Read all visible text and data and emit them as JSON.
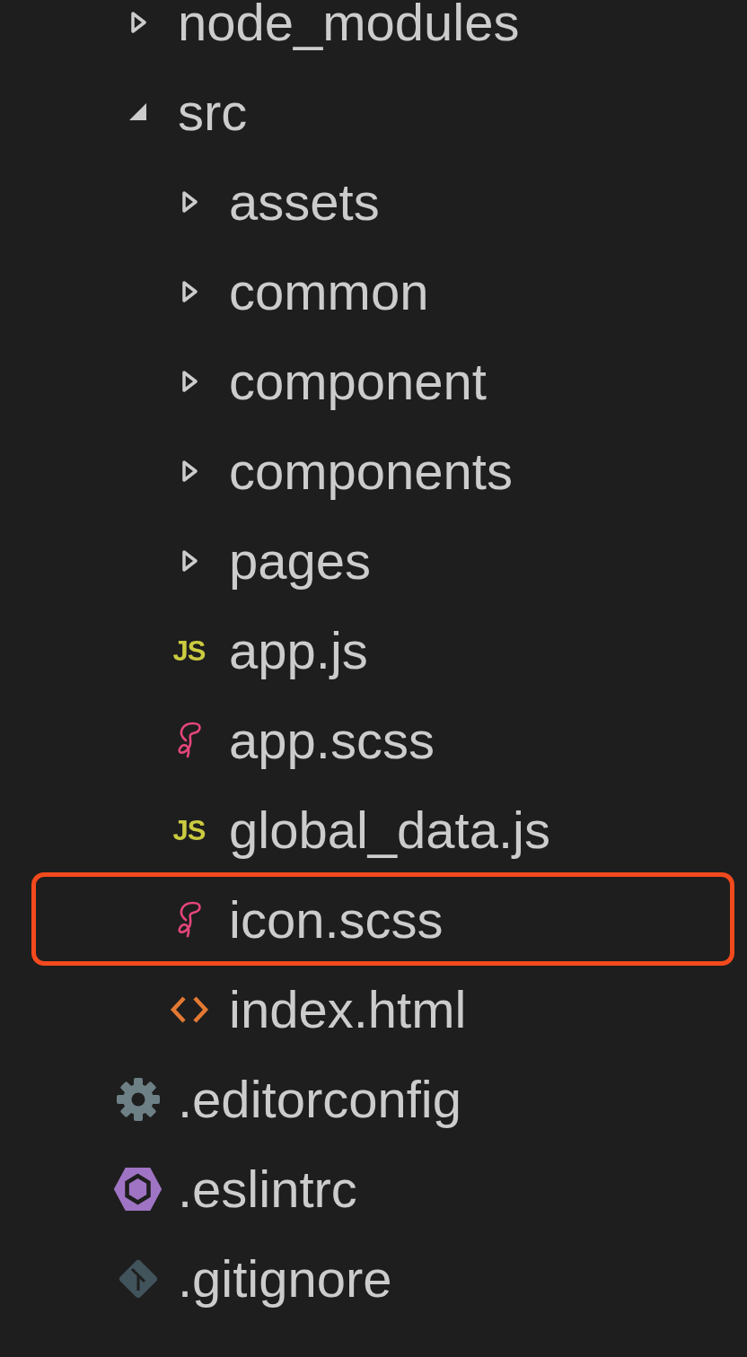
{
  "tree": [
    {
      "name": "node_modules",
      "kind": "folder",
      "expanded": false
    },
    {
      "name": "src",
      "kind": "folder",
      "expanded": true,
      "children": [
        {
          "name": "assets",
          "kind": "folder",
          "expanded": false
        },
        {
          "name": "common",
          "kind": "folder",
          "expanded": false
        },
        {
          "name": "component",
          "kind": "folder",
          "expanded": false
        },
        {
          "name": "components",
          "kind": "folder",
          "expanded": false
        },
        {
          "name": "pages",
          "kind": "folder",
          "expanded": false
        },
        {
          "name": "app.js",
          "kind": "js",
          "badge": "JS",
          "highlighted": false
        },
        {
          "name": "app.scss",
          "kind": "sass",
          "highlighted": false
        },
        {
          "name": "global_data.js",
          "kind": "js",
          "badge": "JS",
          "highlighted": false
        },
        {
          "name": "icon.scss",
          "kind": "sass",
          "highlighted": true
        },
        {
          "name": "index.html",
          "kind": "html",
          "highlighted": false
        }
      ]
    },
    {
      "name": ".editorconfig",
      "kind": "config",
      "highlighted": false
    },
    {
      "name": ".eslintrc",
      "kind": "eslint",
      "highlighted": false
    },
    {
      "name": ".gitignore",
      "kind": "git",
      "highlighted": false
    }
  ]
}
